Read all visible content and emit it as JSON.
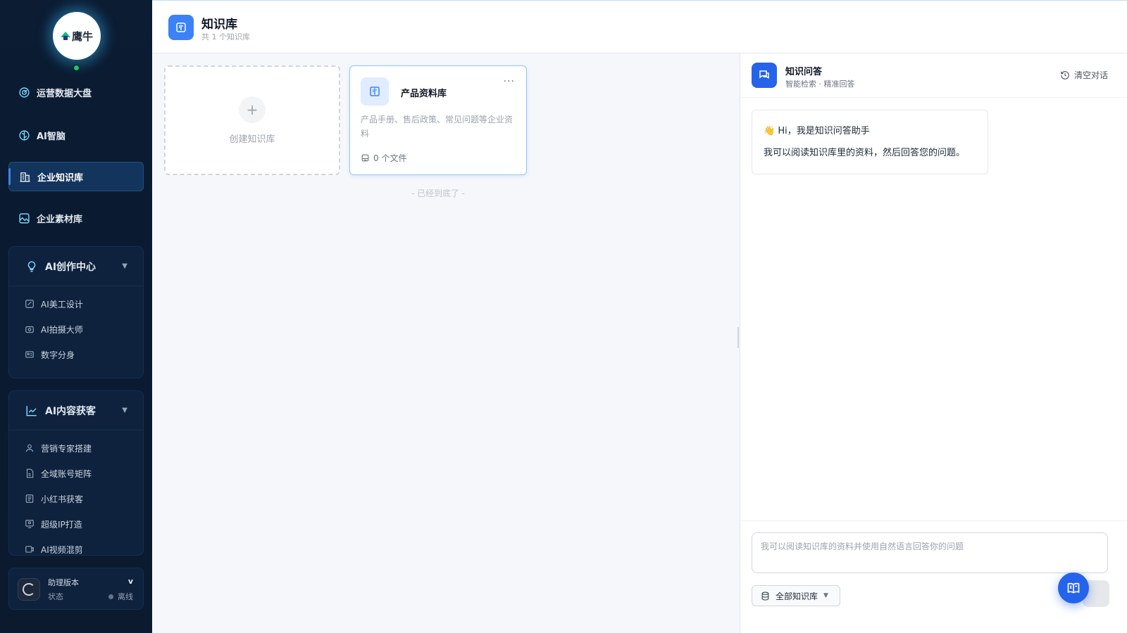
{
  "sidebar": {
    "logo_text": "鹰牛",
    "nav": [
      {
        "label": "运营数据大盘",
        "icon": "dashboard-icon"
      },
      {
        "label": "AI智脑",
        "icon": "brain-icon"
      },
      {
        "label": "企业知识库",
        "icon": "knowledge-base-icon",
        "active": true
      },
      {
        "label": "企业素材库",
        "icon": "image-icon"
      }
    ],
    "groups": [
      {
        "title": "AI创作中心",
        "icon": "lightbulb-icon",
        "items": [
          {
            "label": "AI美工设计",
            "icon": "design-icon"
          },
          {
            "label": "AI拍摄大师",
            "icon": "camera-icon"
          },
          {
            "label": "数字分身",
            "icon": "id-card-icon"
          }
        ]
      },
      {
        "title": "AI内容获客",
        "icon": "trend-chart-icon",
        "items": [
          {
            "label": "营销专家搭建",
            "icon": "user-icon"
          },
          {
            "label": "全域账号矩阵",
            "icon": "document-icon"
          },
          {
            "label": "小红书获客",
            "icon": "ai-doc-icon"
          },
          {
            "label": "超级IP打造",
            "icon": "monitor-user-icon"
          },
          {
            "label": "AI视频混剪",
            "icon": "video-icon"
          }
        ]
      }
    ],
    "assistant": {
      "version_label": "助理版本",
      "version_value": "v",
      "status_label": "状态",
      "status_value": "离线"
    }
  },
  "header": {
    "title": "知识库",
    "subtitle": "共 1 个知识库"
  },
  "main": {
    "create_label": "创建知识库",
    "cards": [
      {
        "title": "产品资料库",
        "description": "产品手册、售后政策、常见问题等企业资料",
        "files": "0 个文件"
      }
    ],
    "end_text": "- 已经到底了 -"
  },
  "chat": {
    "title": "知识问答",
    "subtitle": "智能检索 · 精准回答",
    "clear_label": "清空对话",
    "greeting": "👋  Hi，我是知识问答助手",
    "intro": "我可以阅读知识库里的资料，然后回答您的问题。",
    "input_placeholder": "我可以阅读知识库的资料并使用自然语言回答你的问题",
    "kb_selector": "全部知识库"
  }
}
